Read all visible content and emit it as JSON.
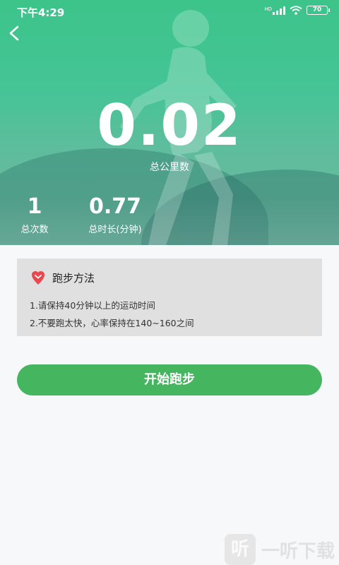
{
  "status_bar": {
    "time": "下午4:29",
    "network_label": "HD",
    "battery": "70"
  },
  "hero": {
    "total_km": "0.02",
    "total_km_label": "总公里数",
    "stats": [
      {
        "value": "1",
        "label": "总次数"
      },
      {
        "value": "0.77",
        "label": "总时长(分钟)"
      }
    ]
  },
  "method": {
    "icon": "heart-pin-icon",
    "title": "跑步方法",
    "tips": [
      "1.请保持40分钟以上的运动时间",
      "2.不要跑太快，心率保持在140~160之间"
    ]
  },
  "actions": {
    "start_label": "开始跑步"
  },
  "watermark": {
    "glyph": "听",
    "text": "一听下载"
  },
  "colors": {
    "hero_green": "#3cc48a",
    "button_green": "#45b55f",
    "panel_gray": "#e0e0e0",
    "icon_red": "#e8474c"
  }
}
